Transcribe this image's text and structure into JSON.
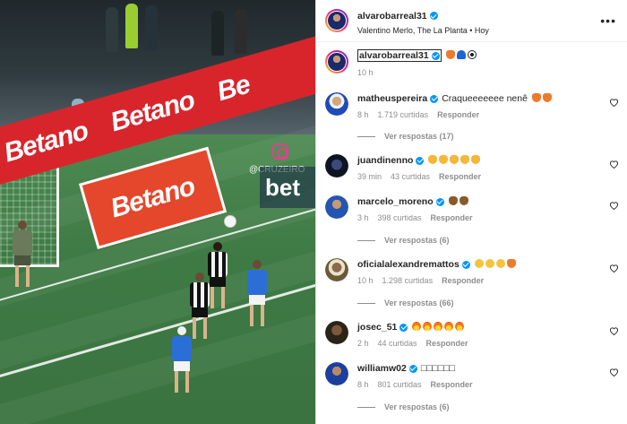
{
  "media": {
    "ad_text": "Betano",
    "ad_text_2": "Betano",
    "ad_text_3": "Be",
    "watermark_handle": "@CRUZEIRO",
    "watermark_bet": "bet"
  },
  "post": {
    "author": "alvarobarreal31",
    "location": "Valentino Merlo, The La Planta • Hoy",
    "more_label": "•••",
    "caption_author": "alvarobarreal31",
    "caption_time": "10 h"
  },
  "comments": [
    {
      "user": "matheuspereira",
      "text": "Craqueeeeeee nenê",
      "time": "8 h",
      "likes": "1.719 curtidas",
      "reply": "Responder",
      "replies": "Ver respostas (17)",
      "emoji": [
        "fox",
        "fox"
      ]
    },
    {
      "user": "juandinenno",
      "text": "",
      "time": "39 min",
      "likes": "43 curtidas",
      "reply": "Responder",
      "replies": "",
      "emoji": [
        "clap",
        "clap",
        "clap",
        "clap",
        "clap"
      ]
    },
    {
      "user": "marcelo_moreno",
      "text": "",
      "time": "3 h",
      "likes": "398 curtidas",
      "reply": "Responder",
      "replies": "Ver respostas (6)",
      "emoji": [
        "clap-dark",
        "clap-dark"
      ]
    },
    {
      "user": "oficialalexandremattos",
      "text": "",
      "time": "10 h",
      "likes": "1.298 curtidas",
      "reply": "Responder",
      "replies": "Ver respostas (66)",
      "emoji": [
        "face",
        "face",
        "face",
        "fox"
      ]
    },
    {
      "user": "josec_51",
      "text": "",
      "time": "2 h",
      "likes": "44 curtidas",
      "reply": "Responder",
      "replies": "",
      "emoji": [
        "fire",
        "fire",
        "fire",
        "fire",
        "fire"
      ]
    },
    {
      "user": "williamw02",
      "text": "□□□□□□",
      "time": "8 h",
      "likes": "801 curtidas",
      "reply": "Responder",
      "replies": "Ver respostas (6)",
      "emoji": []
    }
  ],
  "colors": {
    "verified": "#0095f6",
    "ad_red": "#d8252b",
    "meta_gray": "#8e8e8e"
  }
}
